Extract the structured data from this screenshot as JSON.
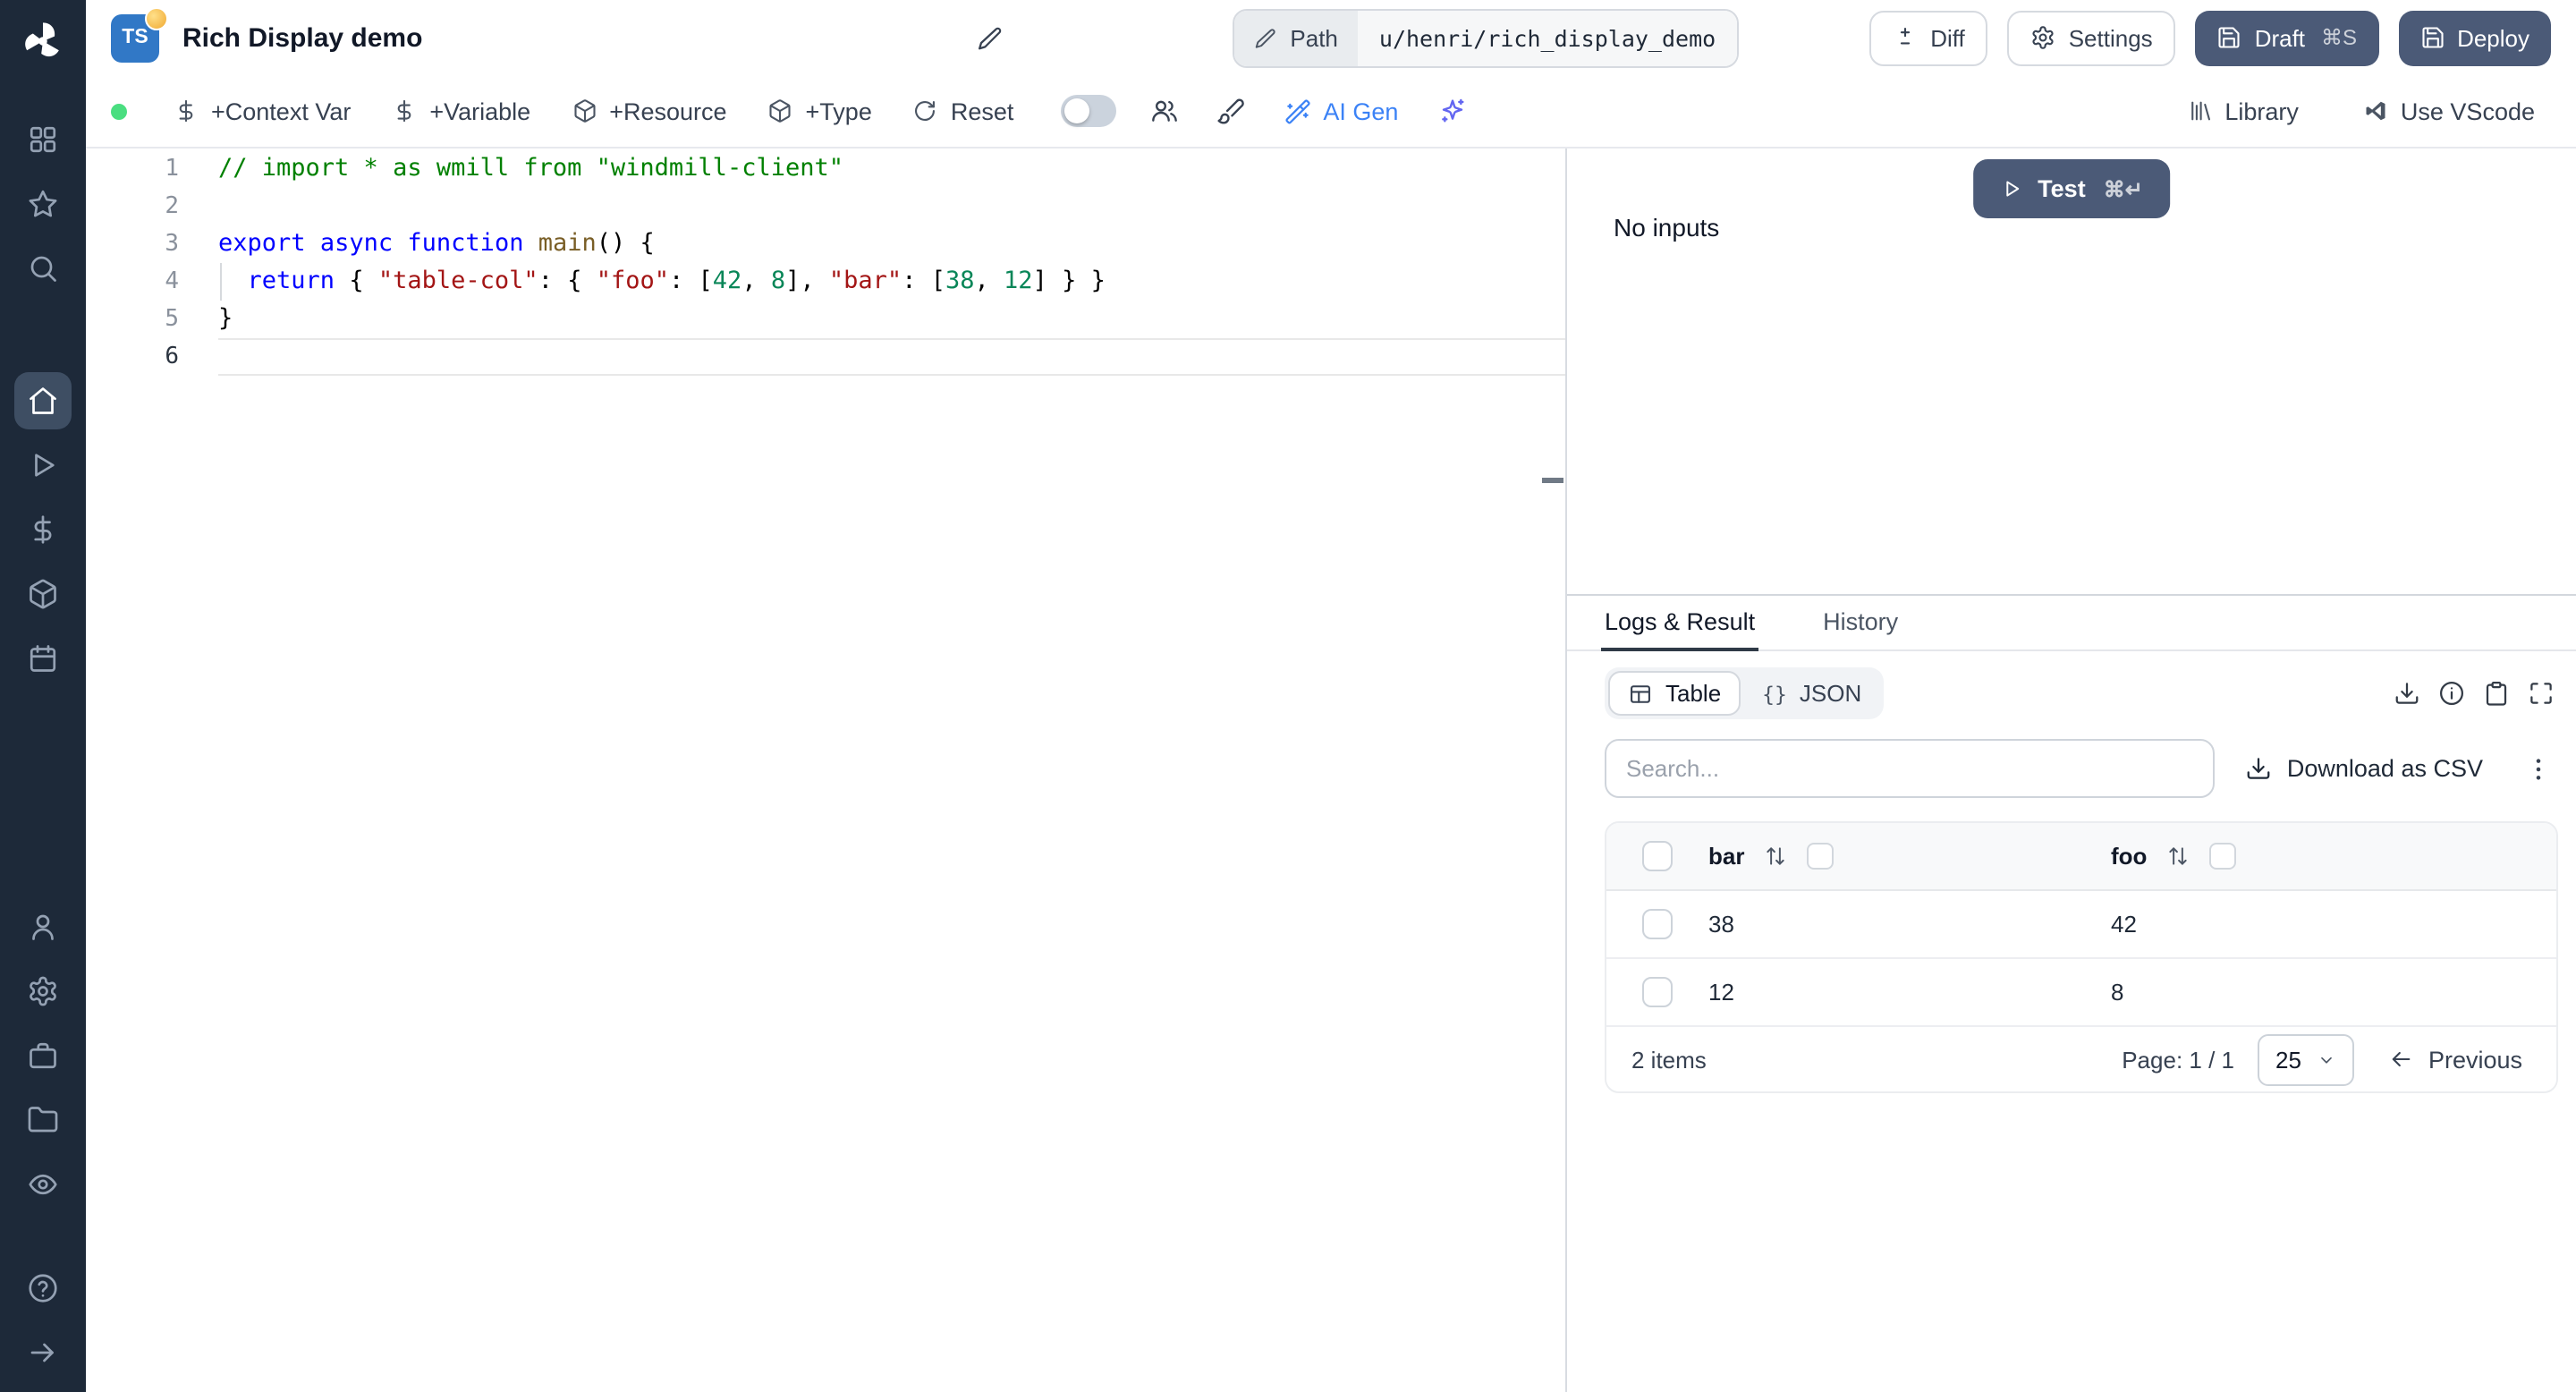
{
  "colors": {
    "sidebar_bg": "#1d2939",
    "dark_button": "#4b5a77",
    "accent_blue": "#3b82f6",
    "status_green": "#4ade80",
    "typescript_badge": "#3178c6"
  },
  "sidebar": {
    "logo": "windmill-logo",
    "top_icons": [
      {
        "name": "apps-grid-icon"
      },
      {
        "name": "favorites-star-icon"
      },
      {
        "name": "search-icon"
      }
    ],
    "main_icons": [
      {
        "name": "home-icon",
        "active": true
      },
      {
        "name": "runs-play-icon"
      },
      {
        "name": "variables-dollar-icon"
      },
      {
        "name": "resources-cube-icon"
      },
      {
        "name": "schedules-calendar-icon"
      }
    ],
    "lower_icons": [
      {
        "name": "user-icon"
      },
      {
        "name": "settings-gear-icon"
      },
      {
        "name": "workers-briefcase-icon"
      },
      {
        "name": "folders-icon"
      },
      {
        "name": "audit-eye-icon"
      }
    ],
    "bottom_icons": [
      {
        "name": "help-icon"
      },
      {
        "name": "collapse-arrow-icon"
      }
    ]
  },
  "header": {
    "lang_badge": "TS",
    "title": "Rich Display demo",
    "path_label": "Path",
    "path_value": "u/henri/rich_display_demo",
    "diff": "Diff",
    "settings": "Settings",
    "draft": "Draft",
    "draft_kbd": "⌘S",
    "deploy": "Deploy"
  },
  "toolbar": {
    "context_var": "+Context Var",
    "variable": "+Variable",
    "resource": "+Resource",
    "type": "+Type",
    "reset": "Reset",
    "ai_gen": "AI Gen",
    "library": "Library",
    "vscode": "Use VScode"
  },
  "editor": {
    "lines": [
      {
        "n": "1",
        "tokens": [
          {
            "c": "comment",
            "t": "// import * as wmill from \"windmill-client\""
          }
        ]
      },
      {
        "n": "2",
        "tokens": []
      },
      {
        "n": "3",
        "tokens": [
          {
            "c": "keyword",
            "t": "export"
          },
          {
            "c": "plain",
            "t": " "
          },
          {
            "c": "keyword",
            "t": "async"
          },
          {
            "c": "plain",
            "t": " "
          },
          {
            "c": "keyword",
            "t": "function"
          },
          {
            "c": "plain",
            "t": " "
          },
          {
            "c": "func",
            "t": "main"
          },
          {
            "c": "plain",
            "t": "() {"
          }
        ]
      },
      {
        "n": "4",
        "tokens": [
          {
            "c": "plain",
            "t": "  "
          },
          {
            "c": "keyword",
            "t": "return"
          },
          {
            "c": "plain",
            "t": " { "
          },
          {
            "c": "string",
            "t": "\"table-col\""
          },
          {
            "c": "plain",
            "t": ": { "
          },
          {
            "c": "string",
            "t": "\"foo\""
          },
          {
            "c": "plain",
            "t": ": ["
          },
          {
            "c": "number",
            "t": "42"
          },
          {
            "c": "plain",
            "t": ", "
          },
          {
            "c": "number",
            "t": "8"
          },
          {
            "c": "plain",
            "t": "], "
          },
          {
            "c": "string",
            "t": "\"bar\""
          },
          {
            "c": "plain",
            "t": ": ["
          },
          {
            "c": "number",
            "t": "38"
          },
          {
            "c": "plain",
            "t": ", "
          },
          {
            "c": "number",
            "t": "12"
          },
          {
            "c": "plain",
            "t": "] } }"
          }
        ]
      },
      {
        "n": "5",
        "tokens": [
          {
            "c": "plain",
            "t": "}"
          }
        ]
      },
      {
        "n": "6",
        "tokens": [],
        "current": true
      }
    ]
  },
  "run": {
    "test": "Test",
    "test_kbd": "⌘↵",
    "no_inputs": "No inputs"
  },
  "result": {
    "tabs": [
      {
        "label": "Logs & Result",
        "active": true
      },
      {
        "label": "History",
        "active": false
      }
    ],
    "view_toggle": {
      "table": "Table",
      "json": "JSON",
      "json_icon": "{}"
    },
    "action_icons": [
      "download-result-icon",
      "info-icon",
      "copy-result-icon",
      "expand-icon"
    ],
    "search_placeholder": "Search...",
    "download_csv": "Download as CSV",
    "table": {
      "columns": [
        "bar",
        "foo"
      ],
      "rows": [
        [
          "38",
          "42"
        ],
        [
          "12",
          "8"
        ]
      ]
    },
    "footer": {
      "items": "2 items",
      "page": "Page: 1 / 1",
      "page_size": "25",
      "previous": "Previous"
    }
  }
}
